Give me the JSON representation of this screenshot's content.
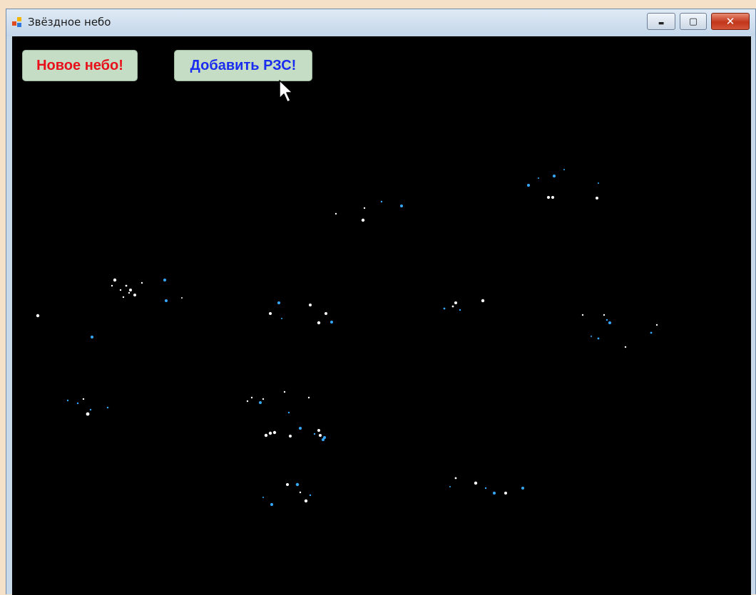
{
  "window": {
    "title": "Звёздное небо",
    "controls": {
      "minimize": "▬",
      "maximize": "▢",
      "close": "✕"
    }
  },
  "toolbar": {
    "new_sky_label": "Новое небо!",
    "add_label": "Добавить РЗС!"
  },
  "colors": {
    "new_sky_text": "#e8101a",
    "add_text": "#1a2cf0",
    "button_bg": "#c5dcc5",
    "sky_bg": "#000000",
    "star_white": "#ffffff",
    "star_blue": "#33aaff"
  }
}
